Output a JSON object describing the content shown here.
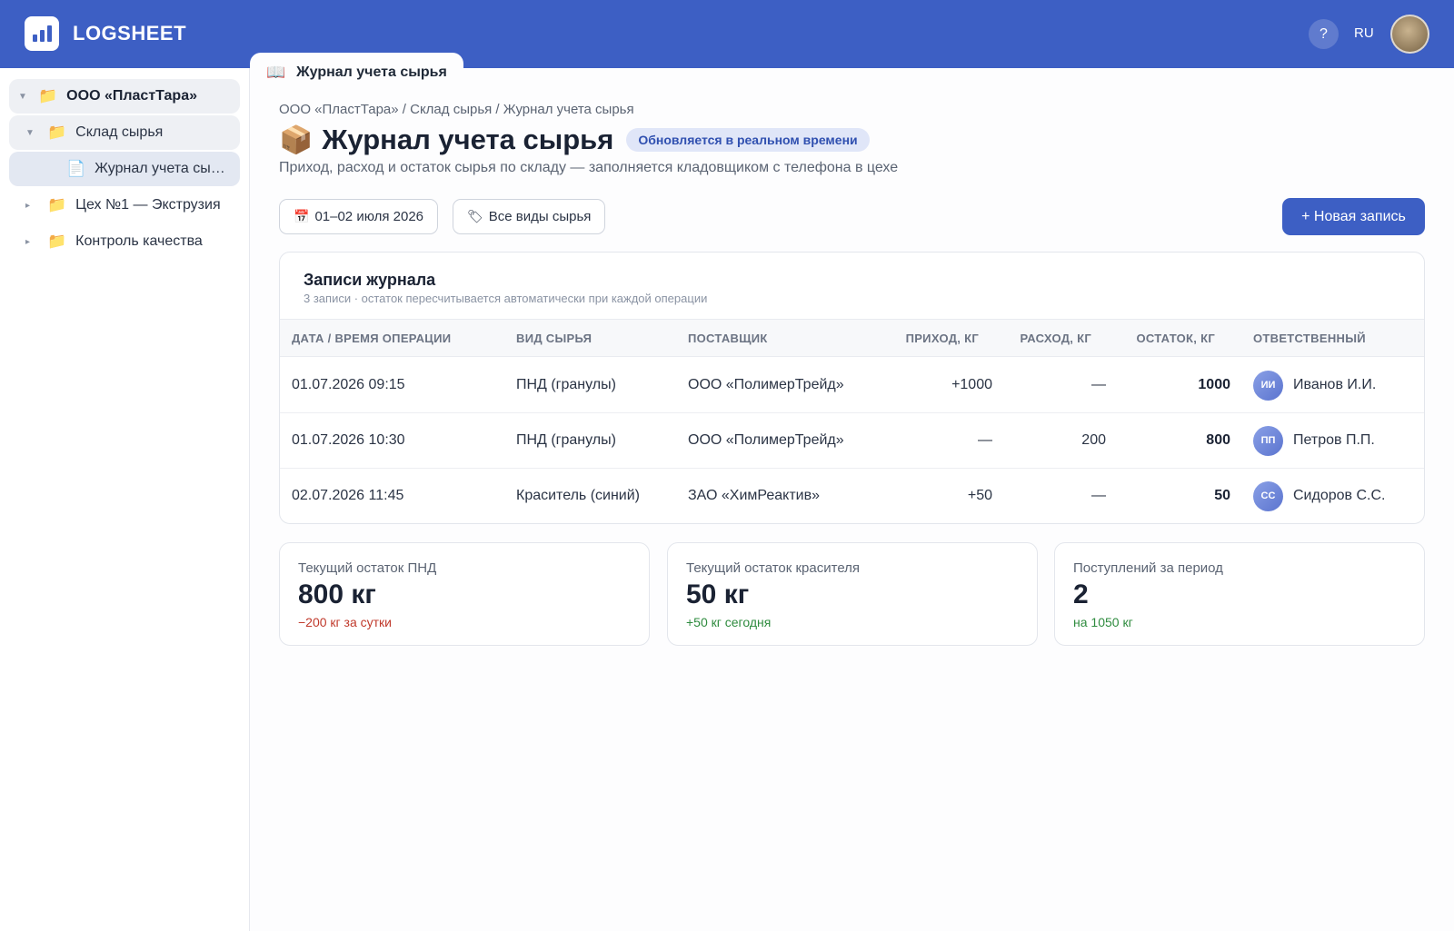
{
  "app": {
    "brand": "LOGSHEET",
    "help": "?",
    "lang": "RU"
  },
  "sidebar": {
    "items": [
      {
        "label": "ООО «ПластТара»",
        "caret": "▼",
        "icon": "📁"
      },
      {
        "label": "Склад сырья",
        "caret": "▼",
        "icon": "📁"
      },
      {
        "label": "Журнал учета сырья",
        "caret": "",
        "icon": "📄"
      },
      {
        "label": "Цех №1 — Экструзия",
        "caret": "▸",
        "icon": "📁"
      },
      {
        "label": "Контроль качества",
        "caret": "▸",
        "icon": "📁"
      }
    ]
  },
  "tab": {
    "icon": "📖",
    "label": "Журнал учета сырья"
  },
  "page": {
    "breadcrumb": "ООО «ПластТара» / Склад сырья / Журнал учета сырья",
    "emoji": "📦",
    "title": "Журнал учета сырья",
    "badge": "Обновляется в реальном времени",
    "subtitle": "Приход, расход и остаток сырья по складу — заполняется кладовщиком с телефона в цехе"
  },
  "filters": {
    "date_icon": "📅",
    "date": "01–02 июля 2026",
    "type_icon": "🏷",
    "type": "Все виды сырья",
    "new_button": "+ Новая запись"
  },
  "journal": {
    "title": "Записи журнала",
    "subtitle": "3 записи · остаток пересчитывается автоматически при каждой операции",
    "columns": [
      "ДАТА / ВРЕМЯ ОПЕРАЦИИ",
      "ВИД СЫРЬЯ",
      "ПОСТАВЩИК",
      "ПРИХОД, КГ",
      "РАСХОД, КГ",
      "ОСТАТОК, КГ",
      "ОТВЕТСТВЕННЫЙ"
    ],
    "rows": [
      {
        "datetime": "01.07.2026 09:15",
        "material": "ПНД (гранулы)",
        "supplier": "ООО «ПолимерТрейд»",
        "income": "+1000",
        "expense": "—",
        "balance": "1000",
        "initials": "ИИ",
        "person": "Иванов И.И."
      },
      {
        "datetime": "01.07.2026 10:30",
        "material": "ПНД (гранулы)",
        "supplier": "ООО «ПолимерТрейд»",
        "income": "—",
        "expense": "200",
        "balance": "800",
        "initials": "ПП",
        "person": "Петров П.П."
      },
      {
        "datetime": "02.07.2026 11:45",
        "material": "Краситель (синий)",
        "supplier": "ЗАО «ХимРеактив»",
        "income": "+50",
        "expense": "—",
        "balance": "50",
        "initials": "СС",
        "person": "Сидоров С.С."
      }
    ]
  },
  "stats": [
    {
      "label": "Текущий остаток ПНД",
      "value": "800 кг",
      "note": "−200 кг за сутки",
      "trend": "negative"
    },
    {
      "label": "Текущий остаток красителя",
      "value": "50 кг",
      "note": "+50 кг сегодня",
      "trend": "positive"
    },
    {
      "label": "Поступлений за период",
      "value": "2",
      "note": "на 1050 кг",
      "trend": "positive"
    }
  ],
  "colors": {
    "primary": "#3d5fc4",
    "negative": "#c0392b",
    "positive": "#2e8b3e"
  }
}
